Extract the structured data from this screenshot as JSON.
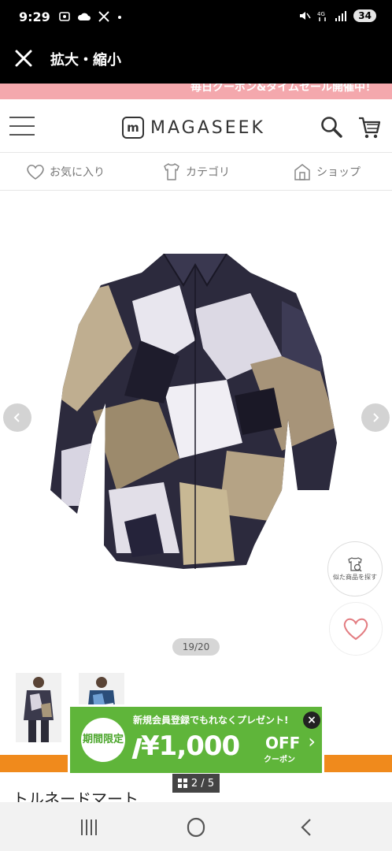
{
  "status_bar": {
    "time": "9:29",
    "left_icons": [
      "screenshot-icon",
      "cloud-icon",
      "x-app-icon",
      "dot-icon"
    ],
    "right_icons": [
      "mute-icon",
      "data-icon",
      "signal-icon"
    ],
    "battery": "34"
  },
  "app_header": {
    "title": "拡大・縮小",
    "close_icon": "close-icon"
  },
  "site": {
    "promo_text": "毎日クーポン&タイムセール開催中！",
    "logo_mark": "m",
    "logo_text": "MAGASEEK",
    "sub_nav": [
      {
        "label": "お気に入り",
        "icon": "heart-icon"
      },
      {
        "label": "カテゴリ",
        "icon": "shirt-icon"
      },
      {
        "label": "ショップ",
        "icon": "shop-icon"
      }
    ]
  },
  "viewer": {
    "counter": "19/20",
    "similar_label": "似た商品を探す",
    "thumbnails": 2
  },
  "coupon": {
    "badge": "期間限定",
    "headline": "新規会員登録でもれなくプレゼント!",
    "amount": "¥1,000",
    "off": "OFF",
    "sub": "クーポン"
  },
  "page_indicator": "2 / 5",
  "shop_name": "トルネードマート",
  "colors": {
    "accent_orange": "#f08a1c",
    "coupon_green": "#5fb53a",
    "promo_pink": "#f4a8ad"
  }
}
